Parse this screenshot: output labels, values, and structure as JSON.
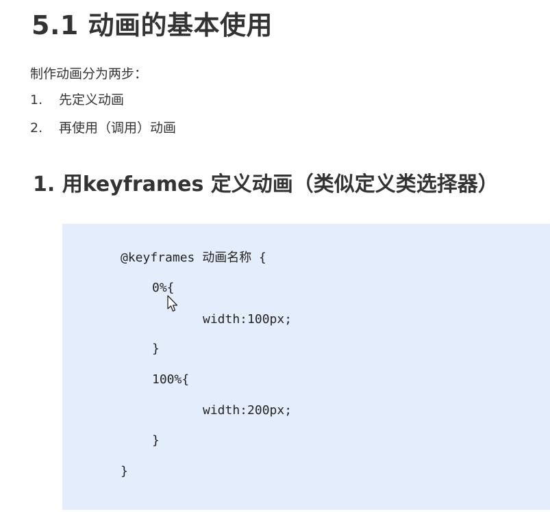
{
  "title": "5.1 动画的基本使用",
  "intro": "制作动画分为两步：",
  "steps": [
    {
      "num": "1.",
      "text": "先定义动画"
    },
    {
      "num": "2.",
      "text": "再使用（调用）动画"
    }
  ],
  "section_heading": "1. 用keyframes 定义动画（类似定义类选择器）",
  "code": {
    "lines": [
      "@keyframes 动画名称 {",
      "0%{",
      "width:100px;",
      "}",
      "100%{",
      "width:200px;",
      "}",
      "}"
    ],
    "background": "#e4edfb"
  },
  "cursor": {
    "icon": "mouse-pointer-icon"
  }
}
